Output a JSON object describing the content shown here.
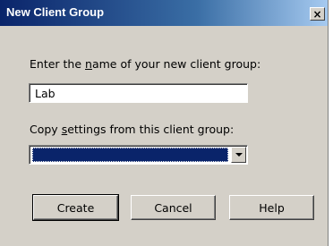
{
  "dialog": {
    "title": "New Client Group",
    "close_glyph": "×"
  },
  "name_field": {
    "label_pre": "Enter the ",
    "label_mnemonic": "n",
    "label_post": "ame of your new client group:",
    "value": "Lab"
  },
  "copy_field": {
    "label_pre": "Copy ",
    "label_mnemonic": "s",
    "label_post": "ettings from this client group:",
    "selected": ""
  },
  "buttons": {
    "create": "Create",
    "cancel": "Cancel",
    "help": "Help"
  },
  "colors": {
    "title_bar": "#0a246a",
    "dialog_bg": "#d4d0c8",
    "selection": "#0a246a"
  },
  "icons": {
    "close": "close-icon",
    "dropdown": "chevron-down-icon"
  }
}
